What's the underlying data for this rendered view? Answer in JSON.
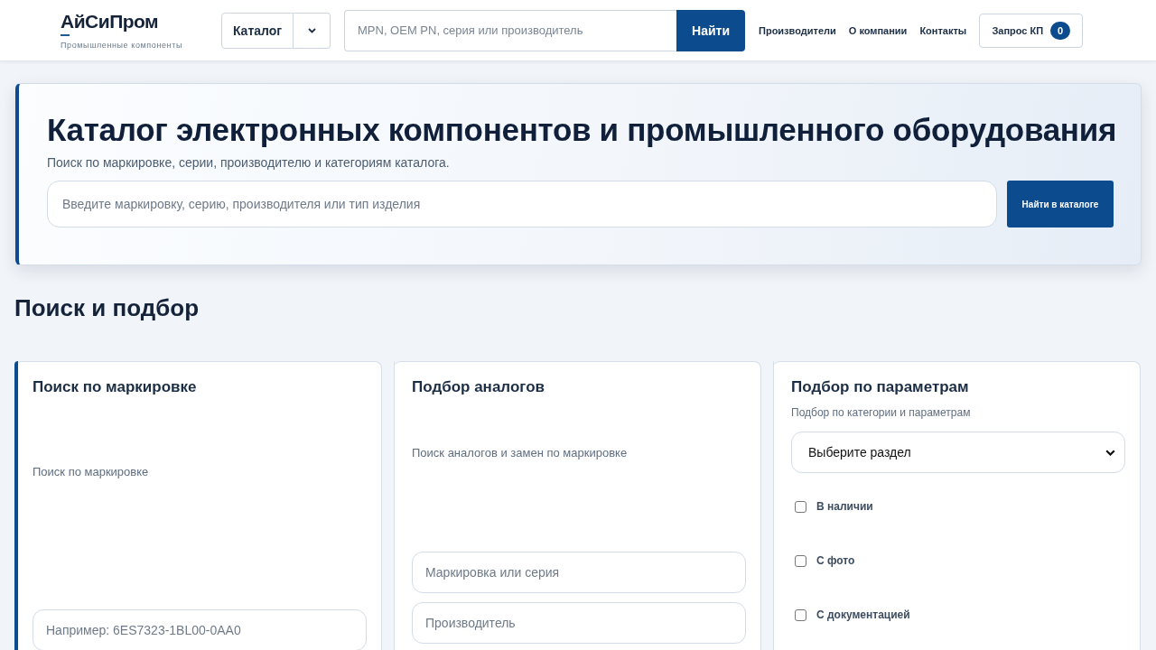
{
  "header": {
    "logo": {
      "name": "АйСиПром",
      "tagline": "Промышленные компоненты"
    },
    "catalog_button": "Каталог",
    "search": {
      "placeholder": "MPN, OEM PN, серия или производитель",
      "button": "Найти"
    },
    "nav": [
      "Производители",
      "О компании",
      "Контакты"
    ],
    "quote_button": {
      "label": "Запрос КП",
      "count": "0"
    }
  },
  "hero": {
    "title": "Каталог электронных компонентов и промышленного оборудования",
    "subtitle": "Поиск по маркировке, серии, производителю и категориям каталога.",
    "search": {
      "placeholder": "Введите маркировку, серию, производителя или тип изделия",
      "button": "Найти в каталоге"
    }
  },
  "section_title": "Поиск и подбор",
  "cards": [
    {
      "title": "Поиск по маркировке",
      "description": "Поиск по маркировке",
      "highlighted": true,
      "fields": [
        {
          "kind": "input",
          "placeholder": "Например: 6ES7323-1BL00-0AA0"
        }
      ]
    },
    {
      "title": "Подбор аналогов",
      "description": "Поиск аналогов и замен по маркировке",
      "highlighted": false,
      "fields": [
        {
          "kind": "input",
          "placeholder": "Маркировка или серия"
        },
        {
          "kind": "input",
          "placeholder": "Производитель"
        }
      ]
    },
    {
      "title": "Подбор по параметрам",
      "description": "Подбор по категории и параметрам",
      "highlighted": false,
      "fields": [
        {
          "kind": "select",
          "value": "Выберите раздел"
        },
        {
          "kind": "checkbox",
          "label": "В наличии",
          "checked": false
        },
        {
          "kind": "checkbox",
          "label": "С фото",
          "checked": false
        },
        {
          "kind": "checkbox",
          "label": "С документацией",
          "checked": false
        }
      ]
    }
  ]
}
